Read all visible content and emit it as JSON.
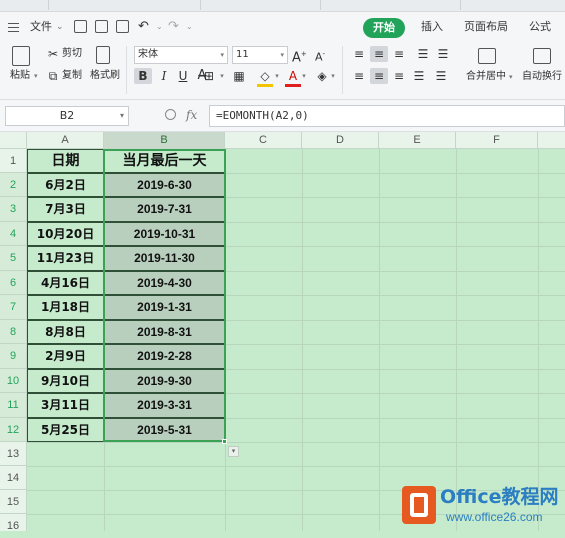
{
  "menu": {
    "file_label": "文件",
    "tabs": [
      "开始",
      "插入",
      "页面布局",
      "公式"
    ]
  },
  "ribbon": {
    "paste_label": "粘贴",
    "cut_label": "剪切",
    "copy_label": "复制",
    "format_painter_label": "格式刷",
    "font_name": "宋体",
    "font_size": "11",
    "merge_center_label": "合并居中",
    "wrap_text_label": "自动换行"
  },
  "formula_bar": {
    "name_box": "B2",
    "fx_label": "fx",
    "formula": "=EOMONTH(A2,0)"
  },
  "sheet": {
    "columns": [
      "A",
      "B",
      "C",
      "D",
      "E",
      "F"
    ],
    "selected_column": "B",
    "rows": [
      "1",
      "2",
      "3",
      "4",
      "5",
      "6",
      "7",
      "8",
      "9",
      "10",
      "11",
      "12",
      "13",
      "14",
      "15",
      "16"
    ],
    "header": {
      "a": "日期",
      "b": "当月最后一天"
    },
    "data": [
      {
        "a": "6月2日",
        "b": "2019-6-30"
      },
      {
        "a": "7月3日",
        "b": "2019-7-31"
      },
      {
        "a": "10月20日",
        "b": "2019-10-31"
      },
      {
        "a": "11月23日",
        "b": "2019-11-30"
      },
      {
        "a": "4月16日",
        "b": "2019-4-30"
      },
      {
        "a": "1月18日",
        "b": "2019-1-31"
      },
      {
        "a": "8月8日",
        "b": "2019-8-31"
      },
      {
        "a": "2月9日",
        "b": "2019-2-28"
      },
      {
        "a": "9月10日",
        "b": "2019-9-30"
      },
      {
        "a": "3月11日",
        "b": "2019-3-31"
      },
      {
        "a": "5月25日",
        "b": "2019-5-31"
      }
    ]
  },
  "watermark": {
    "title": "Office教程网",
    "url": "www.office26.com"
  },
  "colors": {
    "accent": "#22a35a",
    "grid_background": "#c6ebcc",
    "selection_fill": "#b9cfbd"
  }
}
